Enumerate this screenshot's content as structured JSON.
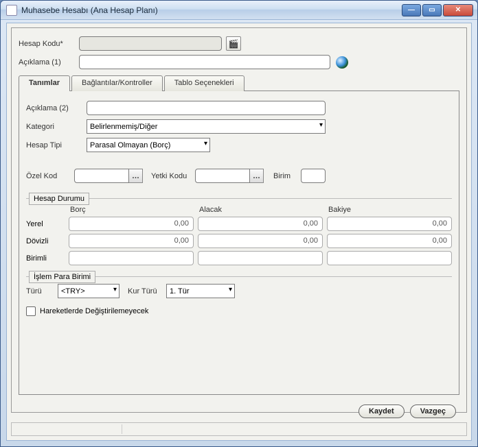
{
  "window": {
    "title": "Muhasebe Hesabı (Ana Hesap Planı)"
  },
  "header": {
    "hesap_kodu_label": "Hesap Kodu*",
    "hesap_kodu_value": "",
    "aciklama1_label": "Açıklama (1)",
    "aciklama1_value": ""
  },
  "tabs": {
    "tanimlar": "Tanımlar",
    "baglantilar": "Bağlantılar/Kontroller",
    "tablo": "Tablo Seçenekleri"
  },
  "tanimlar": {
    "aciklama2_label": "Açıklama (2)",
    "aciklama2_value": "",
    "kategori_label": "Kategori",
    "kategori_value": "Belirlenmemiş/Diğer",
    "hesap_tipi_label": "Hesap Tipi",
    "hesap_tipi_value": "Parasal Olmayan (Borç)",
    "ozel_kod_label": "Özel Kod",
    "ozel_kod_value": "",
    "yetki_kodu_label": "Yetki Kodu",
    "yetki_kodu_value": "",
    "birim_label": "Birim",
    "birim_value": ""
  },
  "hesap_durumu": {
    "title": "Hesap Durumu",
    "columns": {
      "borc": "Borç",
      "alacak": "Alacak",
      "bakiye": "Bakiye"
    },
    "rows": {
      "yerel_label": "Yerel",
      "dovizli_label": "Dövizli",
      "birimli_label": "Birimli"
    },
    "values": {
      "yerel": {
        "borc": "0,00",
        "alacak": "0,00",
        "bakiye": "0,00"
      },
      "dovizli": {
        "borc": "0,00",
        "alacak": "0,00",
        "bakiye": "0,00"
      }
    }
  },
  "islem_para": {
    "title": "İşlem Para Birimi",
    "turu_label": "Türü",
    "turu_value": "<TRY>",
    "kur_turu_label": "Kur Türü",
    "kur_turu_value": "1. Tür",
    "hareket_lock_label": "Hareketlerde Değiştirilemeyecek"
  },
  "footer": {
    "kaydet": "Kaydet",
    "vazgec": "Vazgeç"
  }
}
